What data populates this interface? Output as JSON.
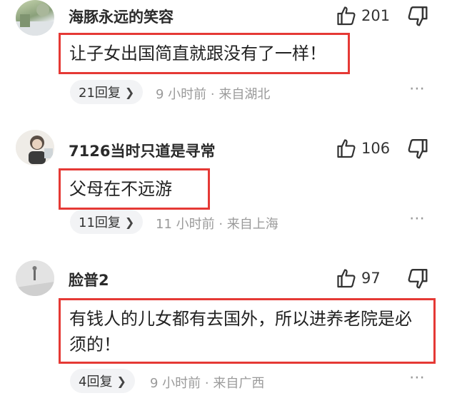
{
  "comments": [
    {
      "username": "海豚永远的笑容",
      "likes": "201",
      "text": "让子女出国简直就跟没有了一样！",
      "replies": "21回复",
      "meta": "9 小时前 · 来自湖北"
    },
    {
      "username": "7126当时只道是寻常",
      "likes": "106",
      "text": "父母在不远游",
      "replies": "11回复",
      "meta": "11 小时前 · 来自上海"
    },
    {
      "username": "脸普2",
      "likes": "97",
      "text": "有钱人的儿女都有去国外，所以进养老院是必须的！",
      "replies": "4回复",
      "meta": "9 小时前 · 来自广西"
    }
  ],
  "icons": {
    "like": "thumbs-up-icon",
    "dislike": "thumbs-down-icon",
    "more": "more-dots-icon",
    "chevron": "chevron-right-icon"
  },
  "colors": {
    "highlight_border": "#e53935",
    "meta_text": "#9a9a9a",
    "pill_bg": "#f2f3f5"
  }
}
